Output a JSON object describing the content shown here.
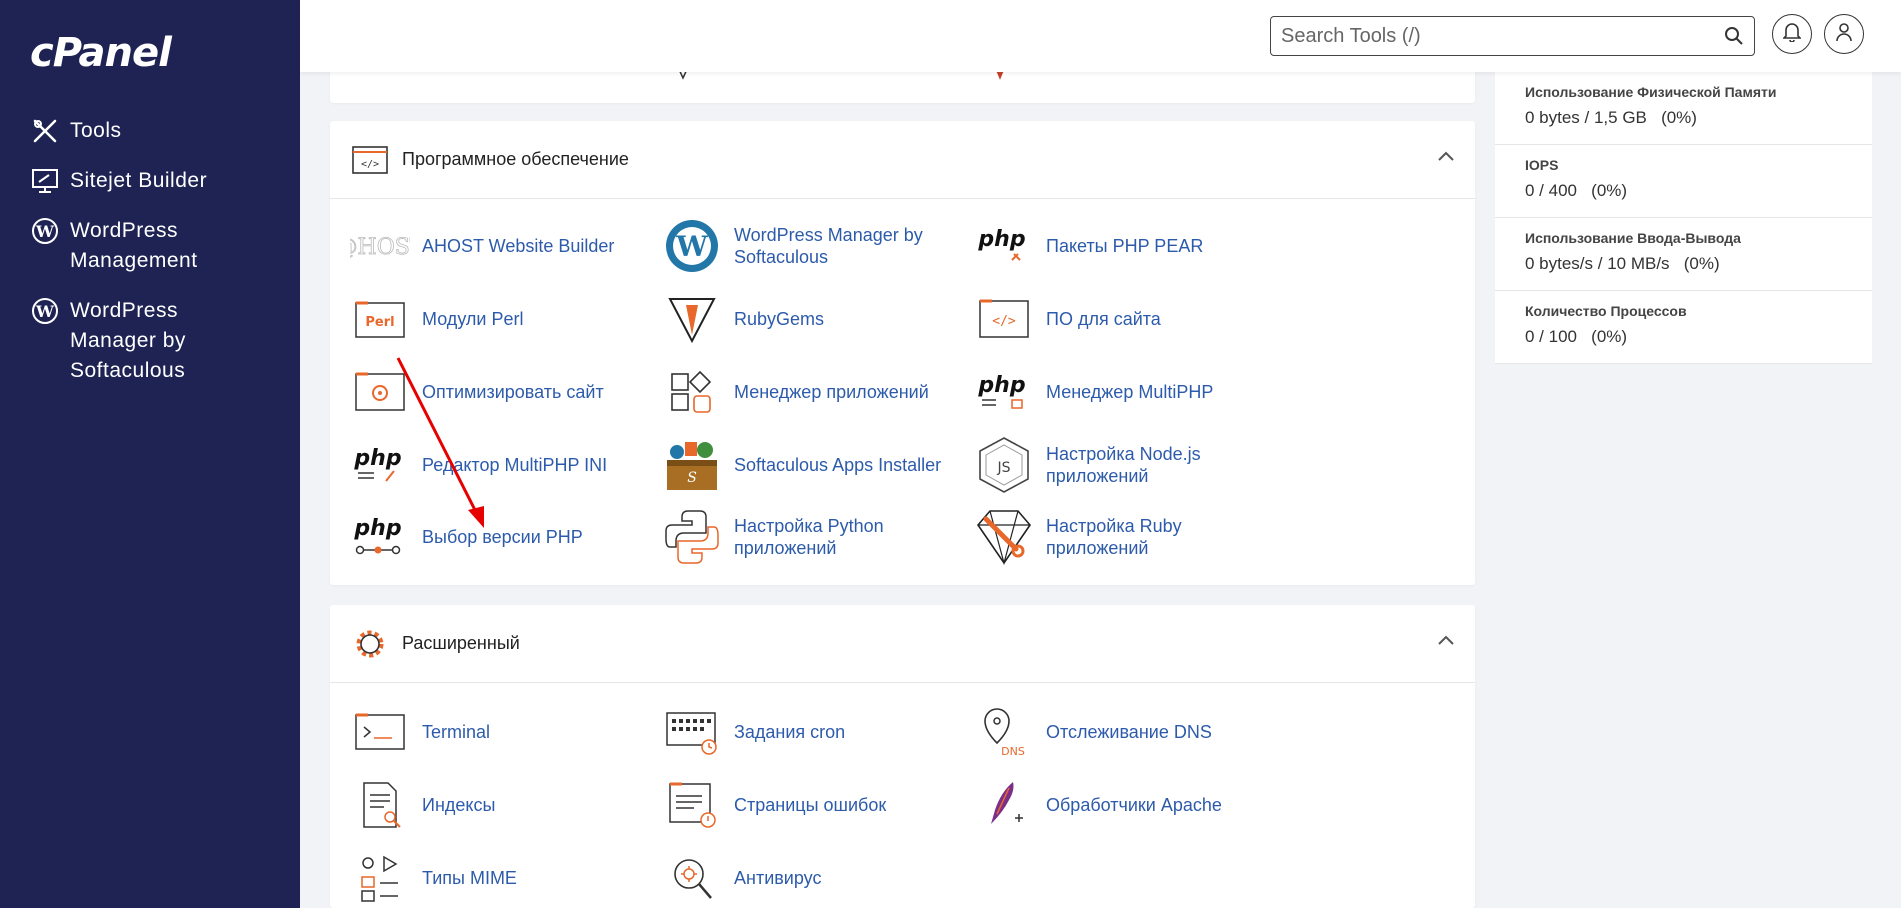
{
  "brand": {
    "logo": "cPanel"
  },
  "sidebar": {
    "items": [
      {
        "label": "Tools",
        "icon": "tools-icon"
      },
      {
        "label": "Sitejet Builder",
        "icon": "sitejet-icon"
      },
      {
        "label": "WordPress Management",
        "icon": "wordpress-icon"
      },
      {
        "label": "WordPress Manager by Softaculous",
        "icon": "wordpress-icon"
      }
    ]
  },
  "header": {
    "search_placeholder": "Search Tools (/)",
    "notifications_icon": "bell-icon",
    "user_icon": "user-icon"
  },
  "sections": {
    "software": {
      "title": "Программное обеспечение",
      "tools": [
        [
          "AHOST Website Builder",
          "WordPress Manager by Softaculous",
          "Пакеты PHP PEAR"
        ],
        [
          "Модули Perl",
          "RubyGems",
          "ПО для сайта"
        ],
        [
          "Оптимизировать сайт",
          "Менеджер приложений",
          "Менеджер MultiPHP"
        ],
        [
          "Редактор MultiPHP INI",
          "Softaculous Apps Installer",
          "Настройка Node.js приложений"
        ],
        [
          "Выбор версии PHP",
          "Настройка Python приложений",
          "Настройка Ruby приложений"
        ]
      ]
    },
    "advanced": {
      "title": "Расширенный",
      "tools": [
        [
          "Terminal",
          "Задания cron",
          "Отслеживание DNS"
        ],
        [
          "Индексы",
          "Страницы ошибок",
          "Обработчики Apache"
        ],
        [
          "Типы MIME",
          "Антивирус"
        ]
      ]
    }
  },
  "stats": [
    {
      "label": "Использование Физической Памяти",
      "value": "0 bytes / 1,5 GB   (0%)"
    },
    {
      "label": "IOPS",
      "value": "0 / 400   (0%)"
    },
    {
      "label": "Использование Ввода-Вывода",
      "value": "0 bytes/s / 10 MB/s   (0%)"
    },
    {
      "label": "Количество Процессов",
      "value": "0 / 100   (0%)"
    }
  ],
  "colors": {
    "sidebar": "#1e2353",
    "link": "#2d5bab",
    "accent": "#e8672a",
    "annotation": "#e60000"
  }
}
